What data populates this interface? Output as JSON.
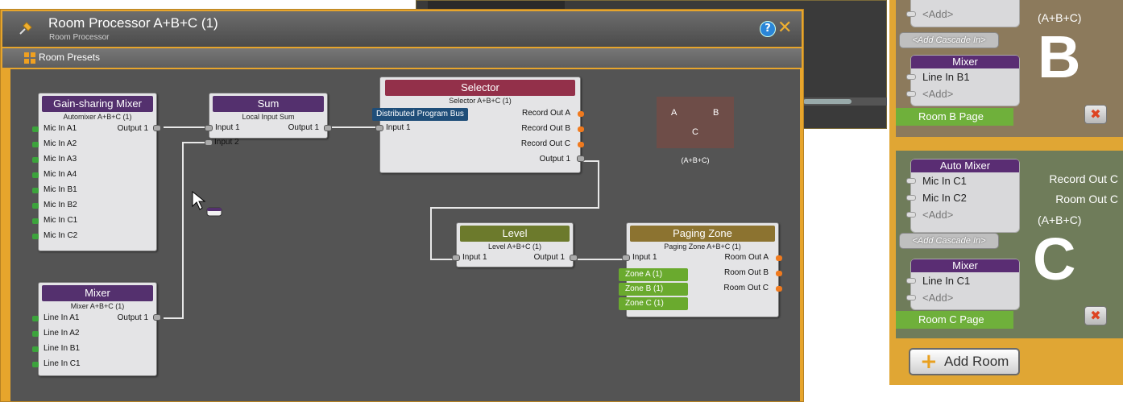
{
  "main_window": {
    "title": "Room Processor A+B+C (1)",
    "subtitle": "Room Processor",
    "help_glyph": "?",
    "close_glyph": "✕",
    "toolbar": {
      "room_presets_label": "Room Presets"
    }
  },
  "blocks": {
    "gain_mixer": {
      "title": "Gain-sharing Mixer",
      "subtitle": "Automixer A+B+C (1)",
      "inputs": [
        "Mic In A1",
        "Mic In A2",
        "Mic In A3",
        "Mic In A4",
        "Mic In B1",
        "Mic In B2",
        "Mic In C1",
        "Mic In C2"
      ],
      "output": "Output 1"
    },
    "sum": {
      "title": "Sum",
      "subtitle": "Local Input Sum",
      "inputs": [
        "Input 1",
        "Input 2"
      ],
      "output": "Output 1"
    },
    "selector": {
      "title": "Selector",
      "subtitle": "Selector A+B+C (1)",
      "bus_tag": "Distributed Program Bus",
      "input": "Input 1",
      "outputs": [
        "Record Out A",
        "Record Out B",
        "Record Out C",
        "Output 1"
      ]
    },
    "mixer": {
      "title": "Mixer",
      "subtitle": "Mixer A+B+C (1)",
      "inputs": [
        "Line In A1",
        "Line In A2",
        "Line In B1",
        "Line In C1"
      ],
      "output": "Output 1"
    },
    "level": {
      "title": "Level",
      "subtitle": "Level A+B+C (1)",
      "input": "Input 1",
      "output": "Output 1"
    },
    "paging": {
      "title": "Paging Zone",
      "subtitle": "Paging Zone A+B+C (1)",
      "input": "Input 1",
      "zones": [
        "Zone A (1)",
        "Zone B (1)",
        "Zone C (1)"
      ],
      "outputs": [
        "Room Out A",
        "Room Out B",
        "Room Out C"
      ]
    },
    "room_map": {
      "a": "A",
      "b": "B",
      "c": "C",
      "label": "(A+B+C)"
    }
  },
  "right_panel": {
    "room_b": {
      "add_top": "<Add>",
      "cascade": "<Add Cascade In>",
      "combo": "(A+B+C)",
      "letter": "B",
      "mixer_title": "Mixer",
      "mixer_input": "Line In B1",
      "mixer_add": "<Add>",
      "page": "Room B Page"
    },
    "room_c": {
      "auto_title": "Auto Mixer",
      "auto_inputs": [
        "Mic In C1",
        "Mic In C2"
      ],
      "auto_add": "<Add>",
      "outputs": [
        "Record Out C",
        "Room Out C"
      ],
      "combo": "(A+B+C)",
      "letter": "C",
      "cascade": "<Add Cascade In>",
      "mixer_title": "Mixer",
      "mixer_input": "Line In C1",
      "mixer_add": "<Add>",
      "page": "Room C Page"
    },
    "add_room": "Add Room",
    "delete_glyph": "✖"
  },
  "icons": [
    "pushpin-icon",
    "help-icon",
    "close-icon",
    "presets-grid-icon",
    "plus-icon",
    "delete-icon",
    "cursor-icon"
  ],
  "colors": {
    "frame": "#e7a52c",
    "canvas": "#545454",
    "purple": "#54306e",
    "green_port": "#3ca33c",
    "orange_port": "#f07a1e"
  }
}
